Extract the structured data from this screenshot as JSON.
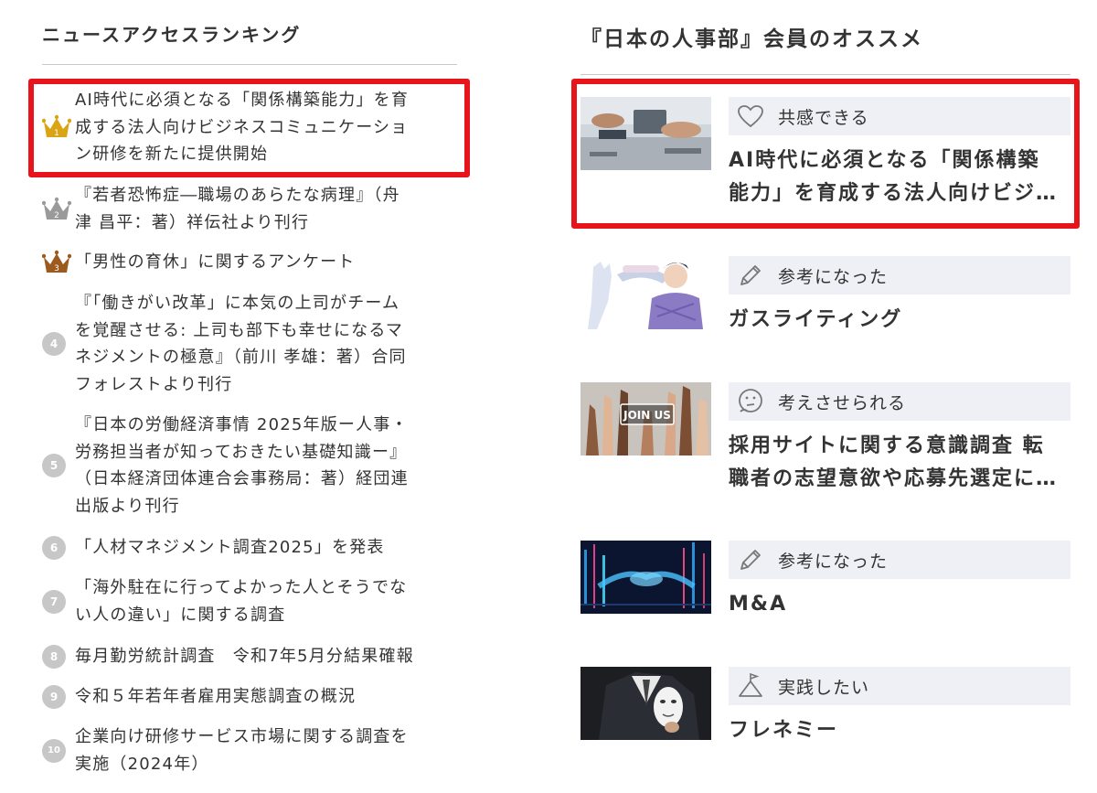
{
  "ranking": {
    "title": "ニュースアクセスランキング",
    "items": [
      {
        "rank": "1",
        "text": "AI時代に必須となる「関係構築能力」を育成する法人向けビジネスコミュニケーション研修を新たに提供開始",
        "lines": [
          "AI時代に必須となる「関係構築能力」を育",
          "成する法人向けビジネスコミュニケーショ",
          "ン研修を新たに提供開始"
        ]
      },
      {
        "rank": "2",
        "text": "『若者恐怖症―職場のあらたな病理』（舟津 昌平：著）祥伝社より刊行",
        "lines": [
          "『若者恐怖症―職場のあらたな病理』（舟",
          "津 昌平：著）祥伝社より刊行"
        ]
      },
      {
        "rank": "3",
        "text": "「男性の育休」に関するアンケート",
        "lines": [
          "「男性の育休」に関するアンケート"
        ]
      },
      {
        "rank": "4",
        "text": "『「働きがい改革」に本気の上司がチームを覚醒させる: 上司も部下も幸せになるマネジメントの極意』（前川 孝雄：著）合同フォレストより刊行",
        "lines": [
          "『「働きがい改革」に本気の上司がチーム",
          "を覚醒させる: 上司も部下も幸せになるマ",
          "ネジメントの極意』（前川 孝雄：著）合同",
          "フォレストより刊行"
        ]
      },
      {
        "rank": "5",
        "text": "『日本の労働経済事情 2025年版ー人事・労務担当者が知っておきたい基礎知識ー』（日本経済団体連合会事務局：著）経団連出版より刊行",
        "lines": [
          "『日本の労働経済事情 2025年版ー人事・",
          "労務担当者が知っておきたい基礎知識ー』",
          "（日本経済団体連合会事務局：著）経団連",
          "出版より刊行"
        ]
      },
      {
        "rank": "6",
        "text": "「人材マネジメント調査2025」を発表",
        "lines": [
          "「人材マネジメント調査2025」を発表"
        ]
      },
      {
        "rank": "7",
        "text": "「海外駐在に行ってよかった人とそうでない人の違い」に関する調査",
        "lines": [
          "「海外駐在に行ってよかった人とそうでな",
          "い人の違い」に関する調査"
        ]
      },
      {
        "rank": "8",
        "text": "毎月勤労統計調査　令和7年5月分結果確報",
        "lines": [
          "毎月勤労統計調査　令和7年5月分結果確報"
        ]
      },
      {
        "rank": "9",
        "text": "令和５年若年者雇用実態調査の概況",
        "lines": [
          "令和５年若年者雇用実態調査の概況"
        ]
      },
      {
        "rank": "10",
        "text": "企業向け研修サービス市場に関する調査を実施（2024年）",
        "lines": [
          "企業向け研修サービス市場に関する調査を",
          "実施（2024年）"
        ]
      }
    ]
  },
  "recommend": {
    "title": "『日本の人事部』会員のオススメ",
    "items": [
      {
        "reaction": "共感できる",
        "reaction_icon": "heart-icon",
        "title_lines": [
          "AI時代に必須となる「関係構築",
          "能力」を育成する法人向けビジ…"
        ],
        "thumb": "business-meeting-photo"
      },
      {
        "reaction": "参考になった",
        "reaction_icon": "pencil-icon",
        "title_lines": [
          "ガスライティング"
        ],
        "thumb": "gaslighting-illustration"
      },
      {
        "reaction": "考えさせられる",
        "reaction_icon": "thinking-face-icon",
        "title_lines": [
          "採用サイトに関する意識調査 転",
          "職者の志望意欲や応募先選定に…"
        ],
        "thumb": "join-us-hands-photo",
        "thumb_text": "JOIN US"
      },
      {
        "reaction": "参考になった",
        "reaction_icon": "pencil-icon",
        "title_lines": [
          "M&A"
        ],
        "thumb": "digital-handshake-photo"
      },
      {
        "reaction": "実践したい",
        "reaction_icon": "flag-mountain-icon",
        "title_lines": [
          "フレネミー"
        ],
        "thumb": "mask-businessman-photo"
      }
    ]
  },
  "colors": {
    "highlight": "#e8141b",
    "gold": "#d9a514",
    "silver": "#9a9a9a",
    "bronze": "#9c5a1e",
    "rank_circle": "#c7c7c7",
    "reaction_bg": "#eef0f6"
  }
}
